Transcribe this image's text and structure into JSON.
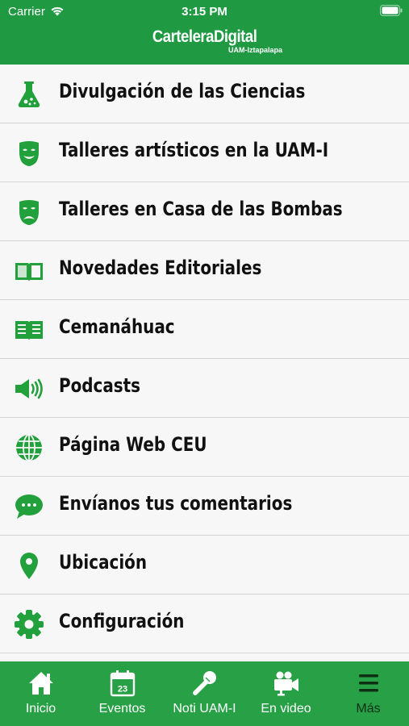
{
  "status": {
    "carrier": "Carrier",
    "time": "3:15 PM"
  },
  "header": {
    "logo_main": "CarteleraDigital",
    "logo_sub": "UAM-Iztapalapa"
  },
  "menu": {
    "items": [
      {
        "label": "Divulgación de las Ciencias",
        "icon": "flask-icon"
      },
      {
        "label": "Talleres artísticos en la UAM-I",
        "icon": "happy-mask-icon"
      },
      {
        "label": "Talleres en Casa de las Bombas",
        "icon": "sad-mask-icon"
      },
      {
        "label": "Novedades Editoriales",
        "icon": "open-book-icon"
      },
      {
        "label": "Cemanáhuac",
        "icon": "newspaper-book-icon"
      },
      {
        "label": "Podcasts",
        "icon": "speaker-icon"
      },
      {
        "label": "Página Web CEU",
        "icon": "globe-icon"
      },
      {
        "label": "Envíanos tus comentarios",
        "icon": "chat-bubble-icon"
      },
      {
        "label": "Ubicación",
        "icon": "location-pin-icon"
      },
      {
        "label": "Configuración",
        "icon": "gear-icon"
      }
    ]
  },
  "tabs": [
    {
      "label": "Inicio",
      "icon": "home-icon"
    },
    {
      "label": "Eventos",
      "icon": "calendar-icon",
      "calendar_day": "23"
    },
    {
      "label": "Noti UAM-I",
      "icon": "microphone-icon"
    },
    {
      "label": "En video",
      "icon": "video-camera-icon"
    },
    {
      "label": "Más",
      "icon": "menu-icon",
      "active": true
    }
  ],
  "colors": {
    "brand_green": "#1f9a43",
    "icon_green": "#22a03c",
    "tab_green": "#28a046"
  }
}
